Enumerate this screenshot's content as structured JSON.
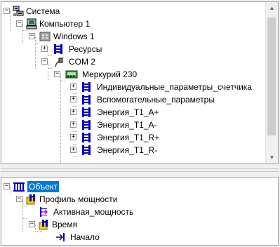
{
  "top_tree": {
    "root": "Система",
    "computer": "Компьютер 1",
    "windows": "Windows 1",
    "resources": "Ресурсы",
    "com": "COM 2",
    "meter": "Меркурий 230",
    "items": [
      "Индивидуальные_параметры_счетчика",
      "Вспомогательные_параметры",
      "Энергия_Т1_А+",
      "Энергия_Т1_А-",
      "Энергия_Т1_R+",
      "Энергия_Т1_R-"
    ]
  },
  "bottom_tree": {
    "root": "Объект",
    "profile": "Профиль мощности",
    "active_power": "Активная_мощность",
    "time": "Время",
    "start": "Начало"
  },
  "colors": {
    "selection": "#0078d7",
    "icon_blue": "#0000c0",
    "icon_yellow": "#f0d000"
  }
}
